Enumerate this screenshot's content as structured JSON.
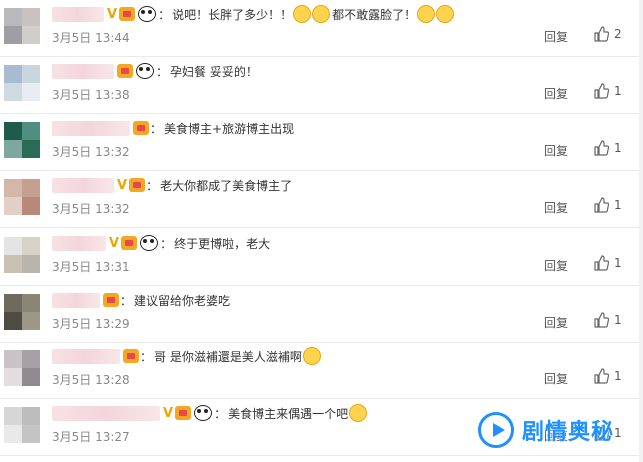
{
  "reply_label": "回复",
  "comments": [
    {
      "text": "说吧！长胖了多少！！",
      "extra_text": "都不敢露脸了！",
      "date": "3月5日",
      "time": "13:44",
      "likes": "2",
      "vip": true,
      "panda": true,
      "avatar": [
        "#b9b9bd",
        "#c8c3c0",
        "#9e9ea4",
        "#d1cdca"
      ],
      "emoji_before_extra": 2,
      "emoji_after": 2,
      "blur_width": 52
    },
    {
      "text": "孕妇餐  妥妥的！",
      "date": "3月5日",
      "time": "13:38",
      "likes": "1",
      "vip": false,
      "panda": true,
      "avatar": [
        "#a7bcd0",
        "#c9d6e0",
        "#cfd9e2",
        "#e6ecf1"
      ],
      "emoji_after": 0,
      "blur_width": 62
    },
    {
      "text": "美食博主+旅游博主出现",
      "date": "3月5日",
      "time": "13:32",
      "likes": "1",
      "vip": false,
      "panda": false,
      "avatar": [
        "#1f5b4a",
        "#4f8f82",
        "#7da8a0",
        "#2c6a58"
      ],
      "emoji_after": 0,
      "blur_width": 78
    },
    {
      "text": "老大你都成了美食博主了",
      "date": "3月5日",
      "time": "13:32",
      "likes": "1",
      "vip": true,
      "panda": false,
      "avatar": [
        "#d3b7a8",
        "#c59f8f",
        "#e2cfc6",
        "#b88978"
      ],
      "emoji_after": 0,
      "blur_width": 62
    },
    {
      "text": "终于更博啦，老大",
      "date": "3月5日",
      "time": "13:31",
      "likes": "1",
      "vip": true,
      "panda": true,
      "avatar": [
        "#e4e4e4",
        "#d8d2c6",
        "#c9c2b2",
        "#b9b5ac"
      ],
      "emoji_after": 0,
      "blur_width": 54
    },
    {
      "text": "建议留给你老婆吃",
      "date": "3月5日",
      "time": "13:29",
      "likes": "1",
      "vip": false,
      "panda": false,
      "avatar": [
        "#6e6a5e",
        "#8a8676",
        "#4e4b43",
        "#9c9787"
      ],
      "emoji_after": 0,
      "blur_width": 48
    },
    {
      "text": "哥  是你滋補還是美人滋補啊",
      "date": "3月5日",
      "time": "13:28",
      "likes": "1",
      "vip": false,
      "panda": false,
      "avatar": [
        "#c9c3c7",
        "#a7a1a6",
        "#e3dde0",
        "#8f8a8d"
      ],
      "emoji_after": 1,
      "blur_width": 68
    },
    {
      "text": "美食博主来偶遇一个吧",
      "date": "3月5日",
      "time": "13:27",
      "likes": "1",
      "vip": true,
      "panda": true,
      "avatar": [
        "#d6d6d6",
        "#bdbdbd",
        "#e9e9e9",
        "#c4c4c4"
      ],
      "emoji_after": 1,
      "blur_width": 108
    }
  ],
  "watermark": {
    "text": "剧情奥秘"
  },
  "colors": {
    "vip": "#f0a500",
    "watermark": "#1e90ff",
    "meta": "#888888"
  }
}
